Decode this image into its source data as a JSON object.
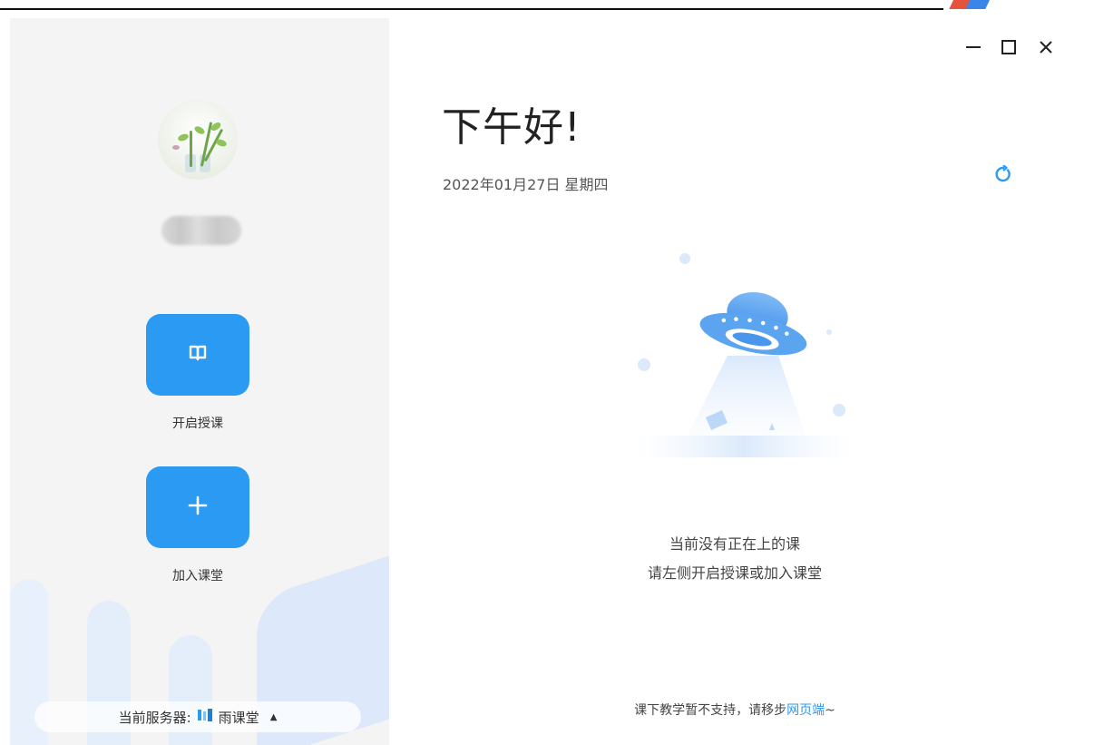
{
  "window": {
    "minimize_icon": "minimize-icon",
    "maximize_icon": "maximize-icon",
    "close_icon": "close-icon"
  },
  "sidebar": {
    "avatar_icon": "avatar-image",
    "start_class": {
      "label": "开启授课",
      "icon": "open-book-icon"
    },
    "join_class": {
      "label": "加入课堂",
      "icon": "plus-icon"
    },
    "server": {
      "label": "当前服务器:",
      "value": "雨课堂",
      "icon": "rain-classroom-logo-icon",
      "toggle_icon": "caret-up-icon"
    }
  },
  "main": {
    "greeting": "下午好!",
    "date": "2022年01月27日 星期四",
    "refresh_icon": "refresh-icon",
    "empty_state": {
      "line1": "当前没有正在上的课",
      "line2": "请左侧开启授课或加入课堂"
    },
    "footer": {
      "text": "课下教学暂不支持，请移步",
      "link": "网页端",
      "suffix": "~"
    }
  },
  "colors": {
    "accent": "#2b9af3",
    "sidebar_bg": "#f4f4f5",
    "text": "#333333"
  }
}
